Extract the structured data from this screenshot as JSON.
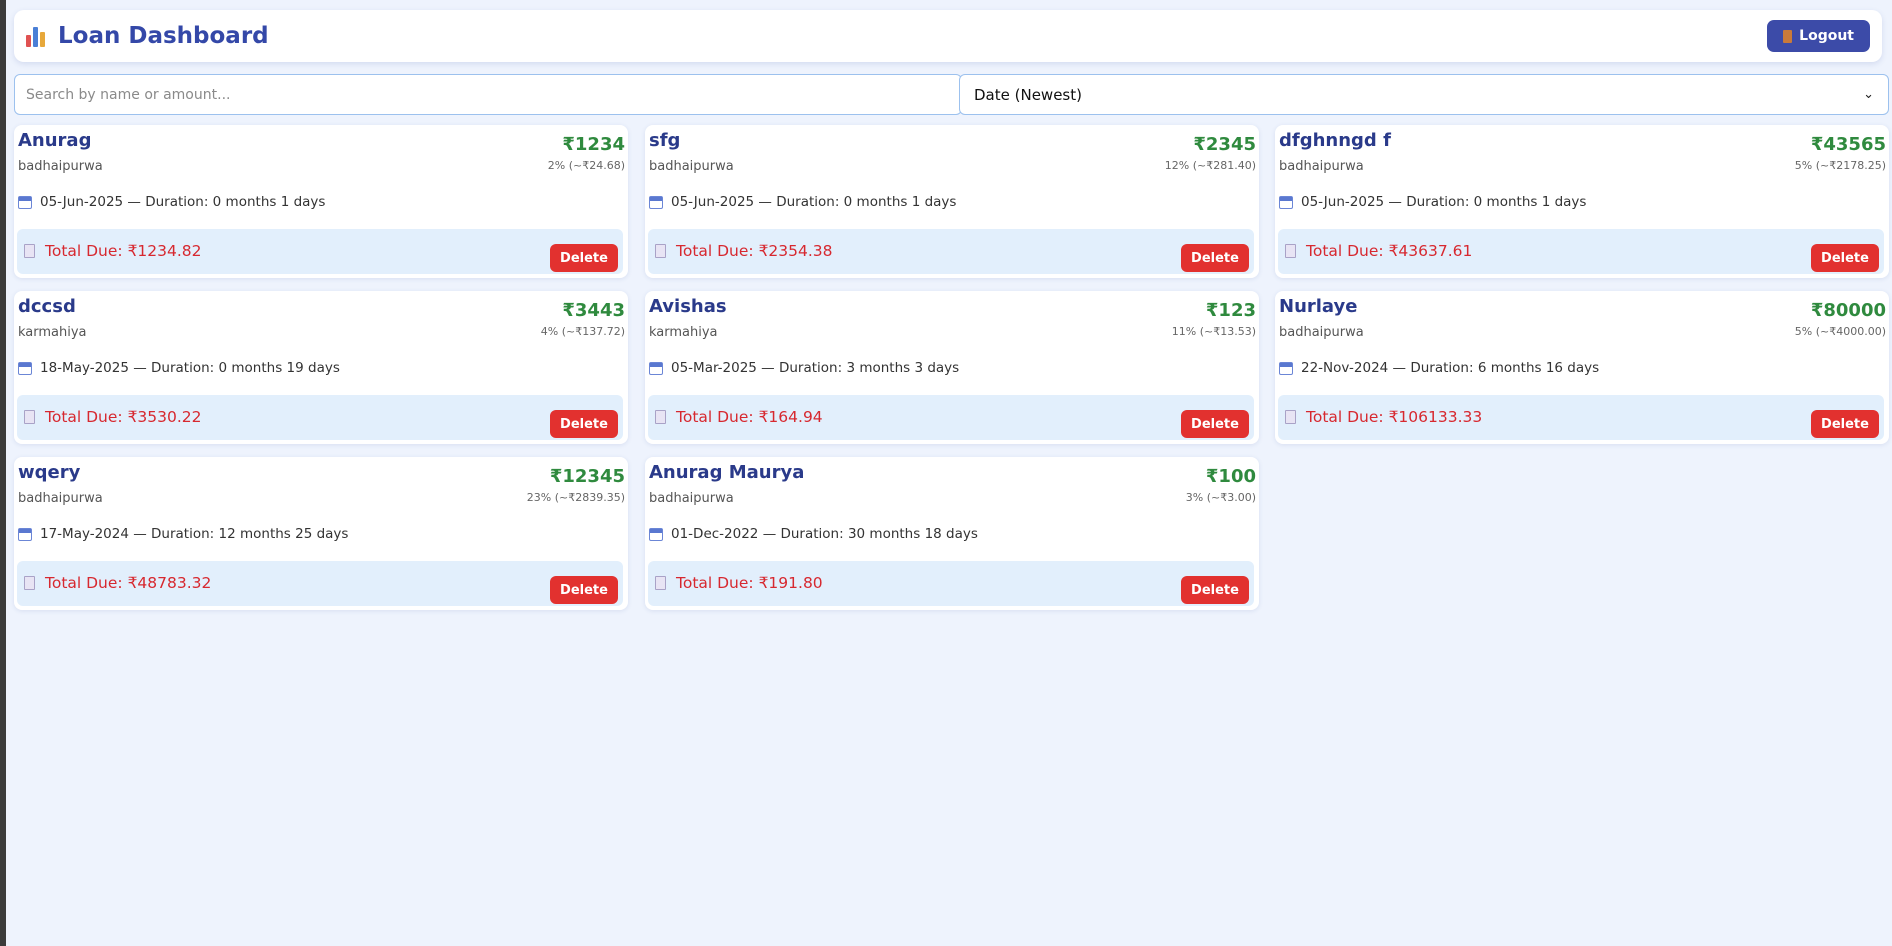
{
  "header": {
    "title": "Loan Dashboard",
    "logout_label": "Logout"
  },
  "search": {
    "placeholder": "Search by name or amount...",
    "value": ""
  },
  "sort": {
    "selected": "Date (Newest)"
  },
  "colors": {
    "accent": "#3c4ba8",
    "amount": "#2f8a3e",
    "due": "#d7282f",
    "delete": "#e2312f",
    "background": "#eef3fd"
  },
  "loans": [
    {
      "name": "Anurag",
      "location": "badhaipurwa",
      "amount": "₹1234",
      "rate": "2% (~₹24.68)",
      "date_duration": "05-Jun-2025 — Duration: 0 months 1 days",
      "total_due": "Total Due: ₹1234.82",
      "delete_label": "Delete"
    },
    {
      "name": "sfg",
      "location": "badhaipurwa",
      "amount": "₹2345",
      "rate": "12% (~₹281.40)",
      "date_duration": "05-Jun-2025 — Duration: 0 months 1 days",
      "total_due": "Total Due: ₹2354.38",
      "delete_label": "Delete"
    },
    {
      "name": "dfghnngd f",
      "location": "badhaipurwa",
      "amount": "₹43565",
      "rate": "5% (~₹2178.25)",
      "date_duration": "05-Jun-2025 — Duration: 0 months 1 days",
      "total_due": "Total Due: ₹43637.61",
      "delete_label": "Delete"
    },
    {
      "name": "dccsd",
      "location": "karmahiya",
      "amount": "₹3443",
      "rate": "4% (~₹137.72)",
      "date_duration": "18-May-2025 — Duration: 0 months 19 days",
      "total_due": "Total Due: ₹3530.22",
      "delete_label": "Delete"
    },
    {
      "name": "Avishas",
      "location": "karmahiya",
      "amount": "₹123",
      "rate": "11% (~₹13.53)",
      "date_duration": "05-Mar-2025 — Duration: 3 months 3 days",
      "total_due": "Total Due: ₹164.94",
      "delete_label": "Delete"
    },
    {
      "name": "Nurlaye",
      "location": "badhaipurwa",
      "amount": "₹80000",
      "rate": "5% (~₹4000.00)",
      "date_duration": "22-Nov-2024 — Duration: 6 months 16 days",
      "total_due": "Total Due: ₹106133.33",
      "delete_label": "Delete"
    },
    {
      "name": "wqery",
      "location": "badhaipurwa",
      "amount": "₹12345",
      "rate": "23% (~₹2839.35)",
      "date_duration": "17-May-2024 — Duration: 12 months 25 days",
      "total_due": "Total Due: ₹48783.32",
      "delete_label": "Delete"
    },
    {
      "name": "Anurag Maurya",
      "location": "badhaipurwa",
      "amount": "₹100",
      "rate": "3% (~₹3.00)",
      "date_duration": "01-Dec-2022 — Duration: 30 months 18 days",
      "total_due": "Total Due: ₹191.80",
      "delete_label": "Delete"
    }
  ]
}
